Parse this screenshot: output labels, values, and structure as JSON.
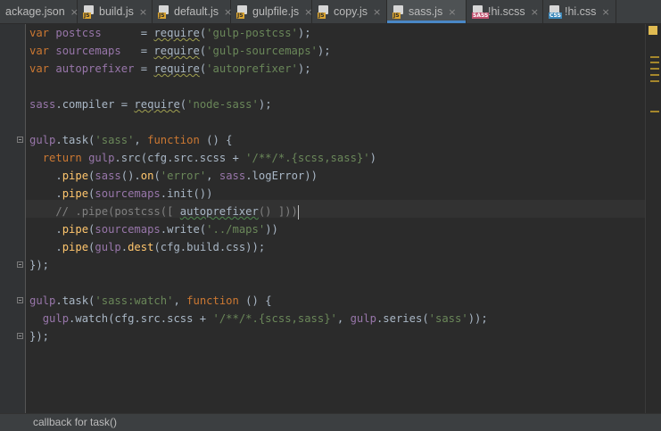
{
  "tabs": [
    {
      "label": "ackage.json",
      "icon": "json-file-icon",
      "badge": "",
      "active": false
    },
    {
      "label": "build.js",
      "icon": "js-file-icon",
      "badge": "JS",
      "active": false
    },
    {
      "label": "default.js",
      "icon": "js-file-icon",
      "badge": "JS",
      "active": false
    },
    {
      "label": "gulpfile.js",
      "icon": "js-file-icon",
      "badge": "JS",
      "active": false
    },
    {
      "label": "copy.js",
      "icon": "js-file-icon",
      "badge": "JS",
      "active": false
    },
    {
      "label": "sass.js",
      "icon": "js-file-icon",
      "badge": "JS",
      "active": true
    },
    {
      "label": "!hi.scss",
      "icon": "sass-file-icon",
      "badge": "SASS",
      "active": false
    },
    {
      "label": "!hi.css",
      "icon": "css-file-icon",
      "badge": "CSS",
      "active": false
    }
  ],
  "close_glyph": "×",
  "code_lines": [
    [
      [
        "kw",
        "var"
      ],
      [
        "def",
        " "
      ],
      [
        "prop",
        "postcss"
      ],
      [
        "def",
        "      = "
      ],
      [
        "sq",
        "require"
      ],
      [
        "def",
        "("
      ],
      [
        "str",
        "'gulp-postcss'"
      ],
      [
        "def",
        ");"
      ]
    ],
    [
      [
        "kw",
        "var"
      ],
      [
        "def",
        " "
      ],
      [
        "prop",
        "sourcemaps"
      ],
      [
        "def",
        "   = "
      ],
      [
        "sq",
        "require"
      ],
      [
        "def",
        "("
      ],
      [
        "str",
        "'gulp-sourcemaps'"
      ],
      [
        "def",
        ");"
      ]
    ],
    [
      [
        "kw",
        "var"
      ],
      [
        "def",
        " "
      ],
      [
        "prop",
        "autoprefixer"
      ],
      [
        "def",
        " = "
      ],
      [
        "sq",
        "require"
      ],
      [
        "def",
        "("
      ],
      [
        "str",
        "'autoprefixer'"
      ],
      [
        "def",
        ");"
      ]
    ],
    [],
    [
      [
        "prop",
        "sass"
      ],
      [
        "def",
        "."
      ],
      [
        "def",
        "compiler = "
      ],
      [
        "sq",
        "require"
      ],
      [
        "def",
        "("
      ],
      [
        "str",
        "'node-sass'"
      ],
      [
        "def",
        ");"
      ]
    ],
    [],
    [
      [
        "prop",
        "gulp"
      ],
      [
        "def",
        "."
      ],
      [
        "def",
        "task("
      ],
      [
        "str",
        "'sass'"
      ],
      [
        "def",
        ", "
      ],
      [
        "kw",
        "function"
      ],
      [
        "def",
        " () {"
      ]
    ],
    [
      [
        "def",
        "  "
      ],
      [
        "kw",
        "return"
      ],
      [
        "def",
        " "
      ],
      [
        "prop",
        "gulp"
      ],
      [
        "def",
        ".src(cfg.src.scss + "
      ],
      [
        "str",
        "'/**/*.{scss,sass}'"
      ],
      [
        "def",
        ")"
      ]
    ],
    [
      [
        "def",
        "    ."
      ],
      [
        "fn",
        "pipe"
      ],
      [
        "def",
        "("
      ],
      [
        "prop",
        "sass"
      ],
      [
        "def",
        "()."
      ],
      [
        "fn",
        "on"
      ],
      [
        "def",
        "("
      ],
      [
        "str",
        "'error'"
      ],
      [
        "def",
        ", "
      ],
      [
        "prop",
        "sass"
      ],
      [
        "def",
        ".logError))"
      ]
    ],
    [
      [
        "def",
        "    ."
      ],
      [
        "fn",
        "pipe"
      ],
      [
        "def",
        "("
      ],
      [
        "prop",
        "sourcemaps"
      ],
      [
        "def",
        ".init())"
      ]
    ],
    [
      [
        "cmt",
        "    // .pipe(postcss([ "
      ],
      [
        "sqg",
        "autoprefixer"
      ],
      [
        "cmt",
        "() ]))"
      ],
      [
        "cursor",
        ""
      ]
    ],
    [
      [
        "def",
        "    ."
      ],
      [
        "fn",
        "pipe"
      ],
      [
        "def",
        "("
      ],
      [
        "prop",
        "sourcemaps"
      ],
      [
        "def",
        ".write("
      ],
      [
        "str",
        "'../maps'"
      ],
      [
        "def",
        "))"
      ]
    ],
    [
      [
        "def",
        "    ."
      ],
      [
        "fn",
        "pipe"
      ],
      [
        "def",
        "("
      ],
      [
        "prop",
        "gulp"
      ],
      [
        "def",
        "."
      ],
      [
        "fn",
        "dest"
      ],
      [
        "def",
        "(cfg.build.css));"
      ]
    ],
    [
      [
        "def",
        "});"
      ]
    ],
    [],
    [
      [
        "prop",
        "gulp"
      ],
      [
        "def",
        "."
      ],
      [
        "def",
        "task("
      ],
      [
        "str",
        "'sass:watch'"
      ],
      [
        "def",
        ", "
      ],
      [
        "kw",
        "function"
      ],
      [
        "def",
        " () {"
      ]
    ],
    [
      [
        "def",
        "  "
      ],
      [
        "prop",
        "gulp"
      ],
      [
        "def",
        ".watch(cfg.src.scss + "
      ],
      [
        "str",
        "'/**/*.{scss,sass}'"
      ],
      [
        "def",
        ", "
      ],
      [
        "prop",
        "gulp"
      ],
      [
        "def",
        ".series("
      ],
      [
        "str",
        "'sass'"
      ],
      [
        "def",
        "));"
      ]
    ],
    [
      [
        "def",
        "});"
      ]
    ]
  ],
  "status": {
    "text": "callback for task()"
  },
  "colors": {
    "keyword": "#cc7832",
    "string": "#6a8759",
    "property": "#9876aa",
    "function": "#ffc66d",
    "comment": "#808080",
    "text": "#a9b7c6",
    "tab_accent": "#4a88c7"
  }
}
